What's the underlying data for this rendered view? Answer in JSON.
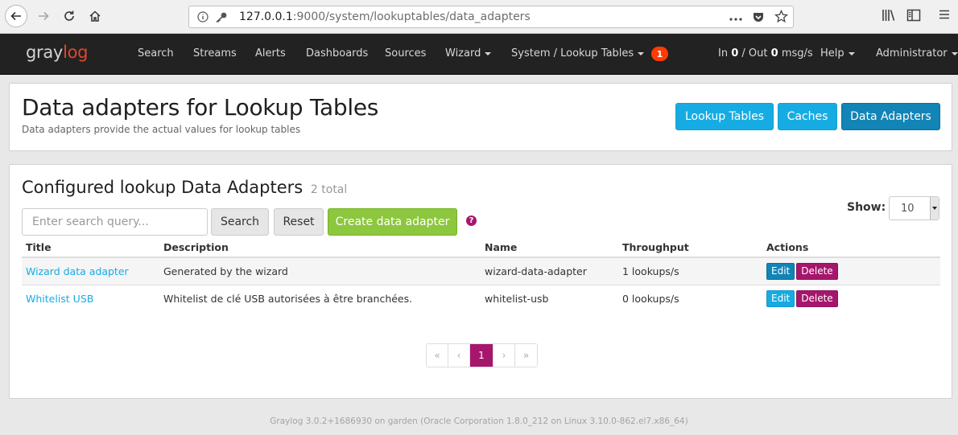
{
  "browser": {
    "url_host": "127.0.0.1",
    "url_path": ":9000/system/lookuptables/data_adapters",
    "icons": [
      "back-icon",
      "forward-icon",
      "reload-icon",
      "home-icon",
      "info-icon",
      "key-icon",
      "more-icon",
      "pocket-icon",
      "star-icon",
      "library-icon",
      "sidebar-icon",
      "menu-icon"
    ]
  },
  "navbar": {
    "brand_gray": "gray",
    "brand_red": "log",
    "items": [
      "Search",
      "Streams",
      "Alerts",
      "Dashboards",
      "Sources"
    ],
    "wizard": "Wizard",
    "system": "System / Lookup Tables",
    "notifications": "1",
    "throughput_in_label": "In",
    "throughput_in": "0",
    "throughput_out_label": "/ Out",
    "throughput_out": "0",
    "throughput_unit": "msg/s",
    "help": "Help",
    "user": "Administrator"
  },
  "header": {
    "title": "Data adapters for Lookup Tables",
    "subtitle": "Data adapters provide the actual values for lookup tables",
    "buttons": [
      "Lookup Tables",
      "Caches",
      "Data Adapters"
    ]
  },
  "main": {
    "title": "Configured lookup Data Adapters",
    "count": "2 total",
    "search_placeholder": "Enter search query...",
    "search_button": "Search",
    "reset_button": "Reset",
    "create_button": "Create data adapter",
    "help_symbol": "?",
    "show_label": "Show:",
    "show_value": "10",
    "columns": [
      "Title",
      "Description",
      "Name",
      "Throughput",
      "Actions"
    ],
    "rows": [
      {
        "title": "Wizard data adapter",
        "description": "Generated by the wizard",
        "name": "wizard-data-adapter",
        "throughput": "1 lookups/s",
        "edit": "Edit",
        "delete": "Delete"
      },
      {
        "title": "Whitelist USB",
        "description": "Whitelist de clé USB autorisées à être branchées.",
        "name": "whitelist-usb",
        "throughput": "0 lookups/s",
        "edit": "Edit",
        "delete": "Delete"
      }
    ],
    "pagination": [
      "«",
      "‹",
      "1",
      "›",
      "»"
    ]
  },
  "footer": "Graylog 3.0.2+1686930 on garden (Oracle Corporation 1.8.0_212 on Linux 3.10.0-862.el7.x86_64)",
  "colors": {
    "navbar_bg": "#222222",
    "info": "#16ace3",
    "success": "#8dc63f",
    "danger": "#a6166c",
    "badge": "#ff3b00"
  }
}
